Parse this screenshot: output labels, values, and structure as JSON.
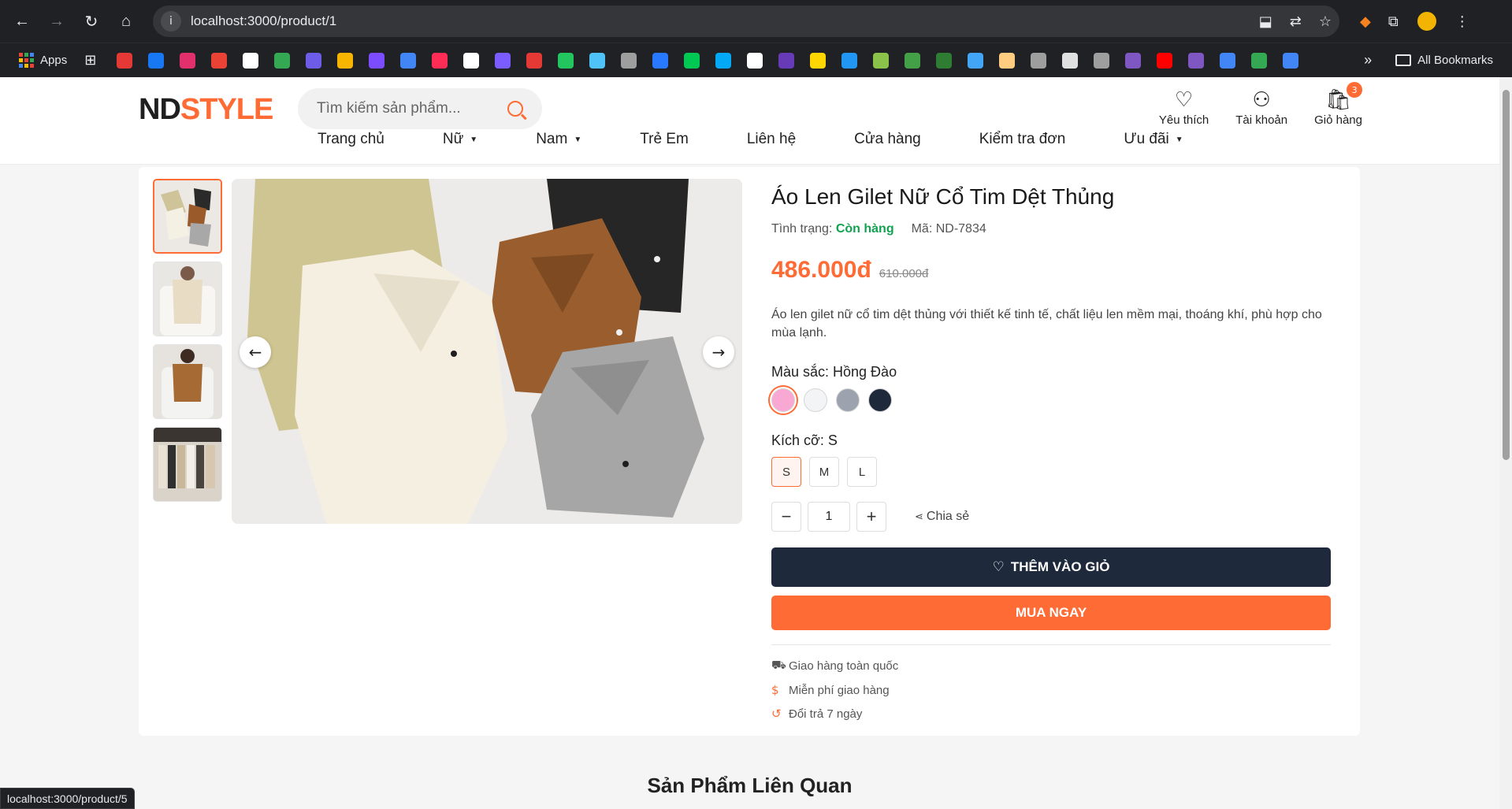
{
  "browser": {
    "url": "localhost:3000/product/1",
    "bookmarks_apps_label": "Apps",
    "all_bookmarks_label": "All Bookmarks",
    "bookmark_colors": [
      "#e53935",
      "#1877f2",
      "#e1306c",
      "#ea4335",
      "#ffffff",
      "#34a853",
      "#6c5ce7",
      "#f7b500",
      "#7c4dff",
      "#4285f4",
      "#ff2d55",
      "#ffffff",
      "#7b5cff",
      "#e53935",
      "#22c55e",
      "#4fc3f7",
      "#9e9e9e",
      "#2979ff",
      "#00c853",
      "#03a9f4",
      "#ffffff",
      "#673ab7",
      "#ffd600",
      "#2196f3",
      "#8bc34a",
      "#43a047",
      "#2e7d32",
      "#42a5f5",
      "#ffcc80",
      "#9e9e9e",
      "#e0e0e0",
      "#9e9e9e",
      "#7e57c2",
      "#ff0000",
      "#7e57c2",
      "#4285f4",
      "#34a853",
      "#4285f4"
    ],
    "status_url": "localhost:3000/product/5"
  },
  "header": {
    "logo_part1": "ND",
    "logo_part2": "STYLE",
    "search_placeholder": "Tìm kiếm sản phẩm...",
    "wishlist_label": "Yêu thích",
    "account_label": "Tài khoản",
    "cart_label": "Giỏ hàng",
    "cart_count": "3"
  },
  "menu": [
    {
      "label": "Trang chủ",
      "dropdown": false
    },
    {
      "label": "Nữ",
      "dropdown": true
    },
    {
      "label": "Nam",
      "dropdown": true
    },
    {
      "label": "Trẻ Em",
      "dropdown": false
    },
    {
      "label": "Liên hệ",
      "dropdown": false
    },
    {
      "label": "Cửa hàng",
      "dropdown": false
    },
    {
      "label": "Kiểm tra đơn",
      "dropdown": false
    },
    {
      "label": "Ưu đãi",
      "dropdown": true
    }
  ],
  "product": {
    "title": "Áo Len Gilet Nữ Cổ Tim Dệt Thủng",
    "status_label": "Tình trạng: ",
    "status_value": "Còn hàng",
    "sku_label": "Mã: ND-7834",
    "price": "486.000đ",
    "old_price": "610.000đ",
    "description": "Áo len gilet nữ cổ tim dệt thủng với thiết kế tinh tế, chất liệu len mềm mại, thoáng khí, phù hợp cho mùa lạnh.",
    "color_label": "Màu sắc: Hồng Đào",
    "colors": [
      "#f9a8d4",
      "#f3f4f6",
      "#9ca3af",
      "#1e293b"
    ],
    "size_label": "Kích cỡ: S",
    "sizes": [
      "S",
      "M",
      "L"
    ],
    "quantity": "1",
    "share_label": "Chia sẻ",
    "add_to_cart": "THÊM VÀO GIỎ",
    "buy_now": "MUA NGAY",
    "features": [
      "Giao hàng toàn quốc",
      "Miễn phí giao hàng",
      "Đổi trả 7 ngày"
    ]
  },
  "related_title": "Sản Phẩm Liên Quan"
}
